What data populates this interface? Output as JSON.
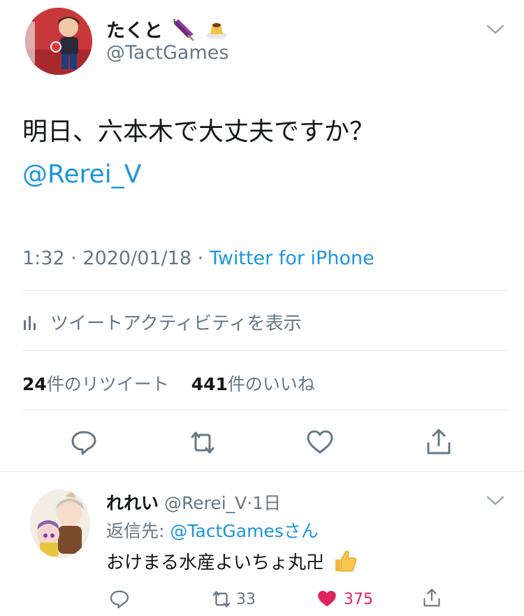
{
  "tweet": {
    "display_name": "たくと",
    "name_emojis": [
      "umbrella-emoji",
      "pudding-emoji"
    ],
    "handle": "@TactGames",
    "text": "明日、六本木で大丈夫ですか？",
    "mention": "@Rerei_V",
    "time": "1:32",
    "date": "2020/01/18",
    "source": "Twitter for iPhone",
    "meta_sep1": " · ",
    "meta_sep2": " · ",
    "activity_label": "ツイートアクティビティを表示",
    "retweet_count": "24",
    "retweet_label": "件のリツイート",
    "like_count": "441",
    "like_label": "件のいいね"
  },
  "reply": {
    "display_name": "れれい",
    "handle": "@Rerei_V",
    "sep": "·",
    "age": "1日",
    "reply_prefix": "返信先: ",
    "reply_to": "@TactGamesさん",
    "text": "おけまる水産よいちょ丸卍",
    "text_emoji": "thumbs-up-emoji",
    "retweet_count": "33",
    "like_count": "375"
  },
  "colors": {
    "link": "#1b95e0",
    "muted": "#657786",
    "like": "#e0245e",
    "divider": "#e1e8ed"
  }
}
